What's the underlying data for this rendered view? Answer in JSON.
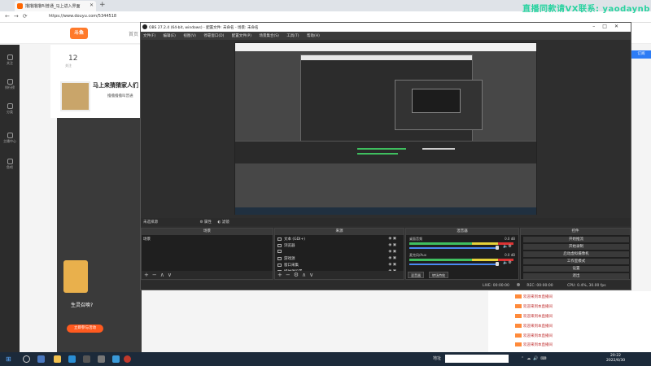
{
  "browser": {
    "tab_title": "撸撸撸撸叫普通_马上进入界面",
    "url": "https://www.douyu.com/5344518",
    "logo": "斗鱼",
    "nav_recommend": "首页",
    "right_button": "订阅"
  },
  "watermark": "直播同款请VX联系: yaodaynb",
  "rail": [
    "关注",
    "排行榜",
    "分类",
    "主播中心",
    "鱼吧"
  ],
  "room": {
    "rank_count": "12",
    "rank_label": "关注",
    "title": "马上来猜猜家人们",
    "streamer": "撸撸撸撸叫普通"
  },
  "ad": {
    "title": "生灵召唤?",
    "button": "立即参与活动"
  },
  "chat": [
    "欢迎来到本直播间",
    "欢迎来到本直播间",
    "欢迎来到本直播间",
    "欢迎来到本直播间",
    "欢迎来到本直播间",
    "欢迎来到本直播间",
    "欢迎来到本直播间"
  ],
  "obs": {
    "title": "OBS 27.2.4 (64-bit, windows) - 配置文件: 未命名 - 场景: 未命名",
    "menu": [
      "文件(F)",
      "编辑(E)",
      "视图(V)",
      "停靠窗口(D)",
      "配置文件(P)",
      "场景集合(S)",
      "工具(T)",
      "帮助(H)"
    ],
    "scene_row_label": "未选择源",
    "scene_row_btn1": "属性",
    "scene_row_btn2": "滤镜",
    "panes": {
      "scenes": "场景",
      "sources": "来源",
      "mixer": "混音器",
      "controls": "控件"
    },
    "scene_item": "场景",
    "sources": [
      {
        "name": "文本 (GDI+)",
        "icon": "text-icon"
      },
      {
        "name": "浏览器",
        "icon": "globe-icon"
      },
      {
        "name": "",
        "icon": "window-icon"
      },
      {
        "name": "游戏源",
        "icon": "gamepad-icon"
      },
      {
        "name": "窗口采集",
        "icon": "window-icon"
      },
      {
        "name": "媒体源设置",
        "icon": "media-icon"
      }
    ],
    "mixer_tracks": [
      {
        "name": "桌面音频",
        "value": "0.0 dB"
      },
      {
        "name": "麦克风/Aux",
        "value": "0.0 dB"
      }
    ],
    "mixer_tabs": [
      "混音器",
      "转场特效"
    ],
    "controls": [
      "开始推流",
      "开始录制",
      "启动虚拟摄像机",
      "工作室模式",
      "设置",
      "退出"
    ],
    "status": {
      "live": "LIVE: 00:00:00",
      "rec": "REC: 00:00:00",
      "cpu": "CPU: 0.4%, 30.00 fps"
    }
  },
  "taskbar": {
    "address_label": "地址",
    "time": "20:22",
    "date": "2022/6/30"
  }
}
